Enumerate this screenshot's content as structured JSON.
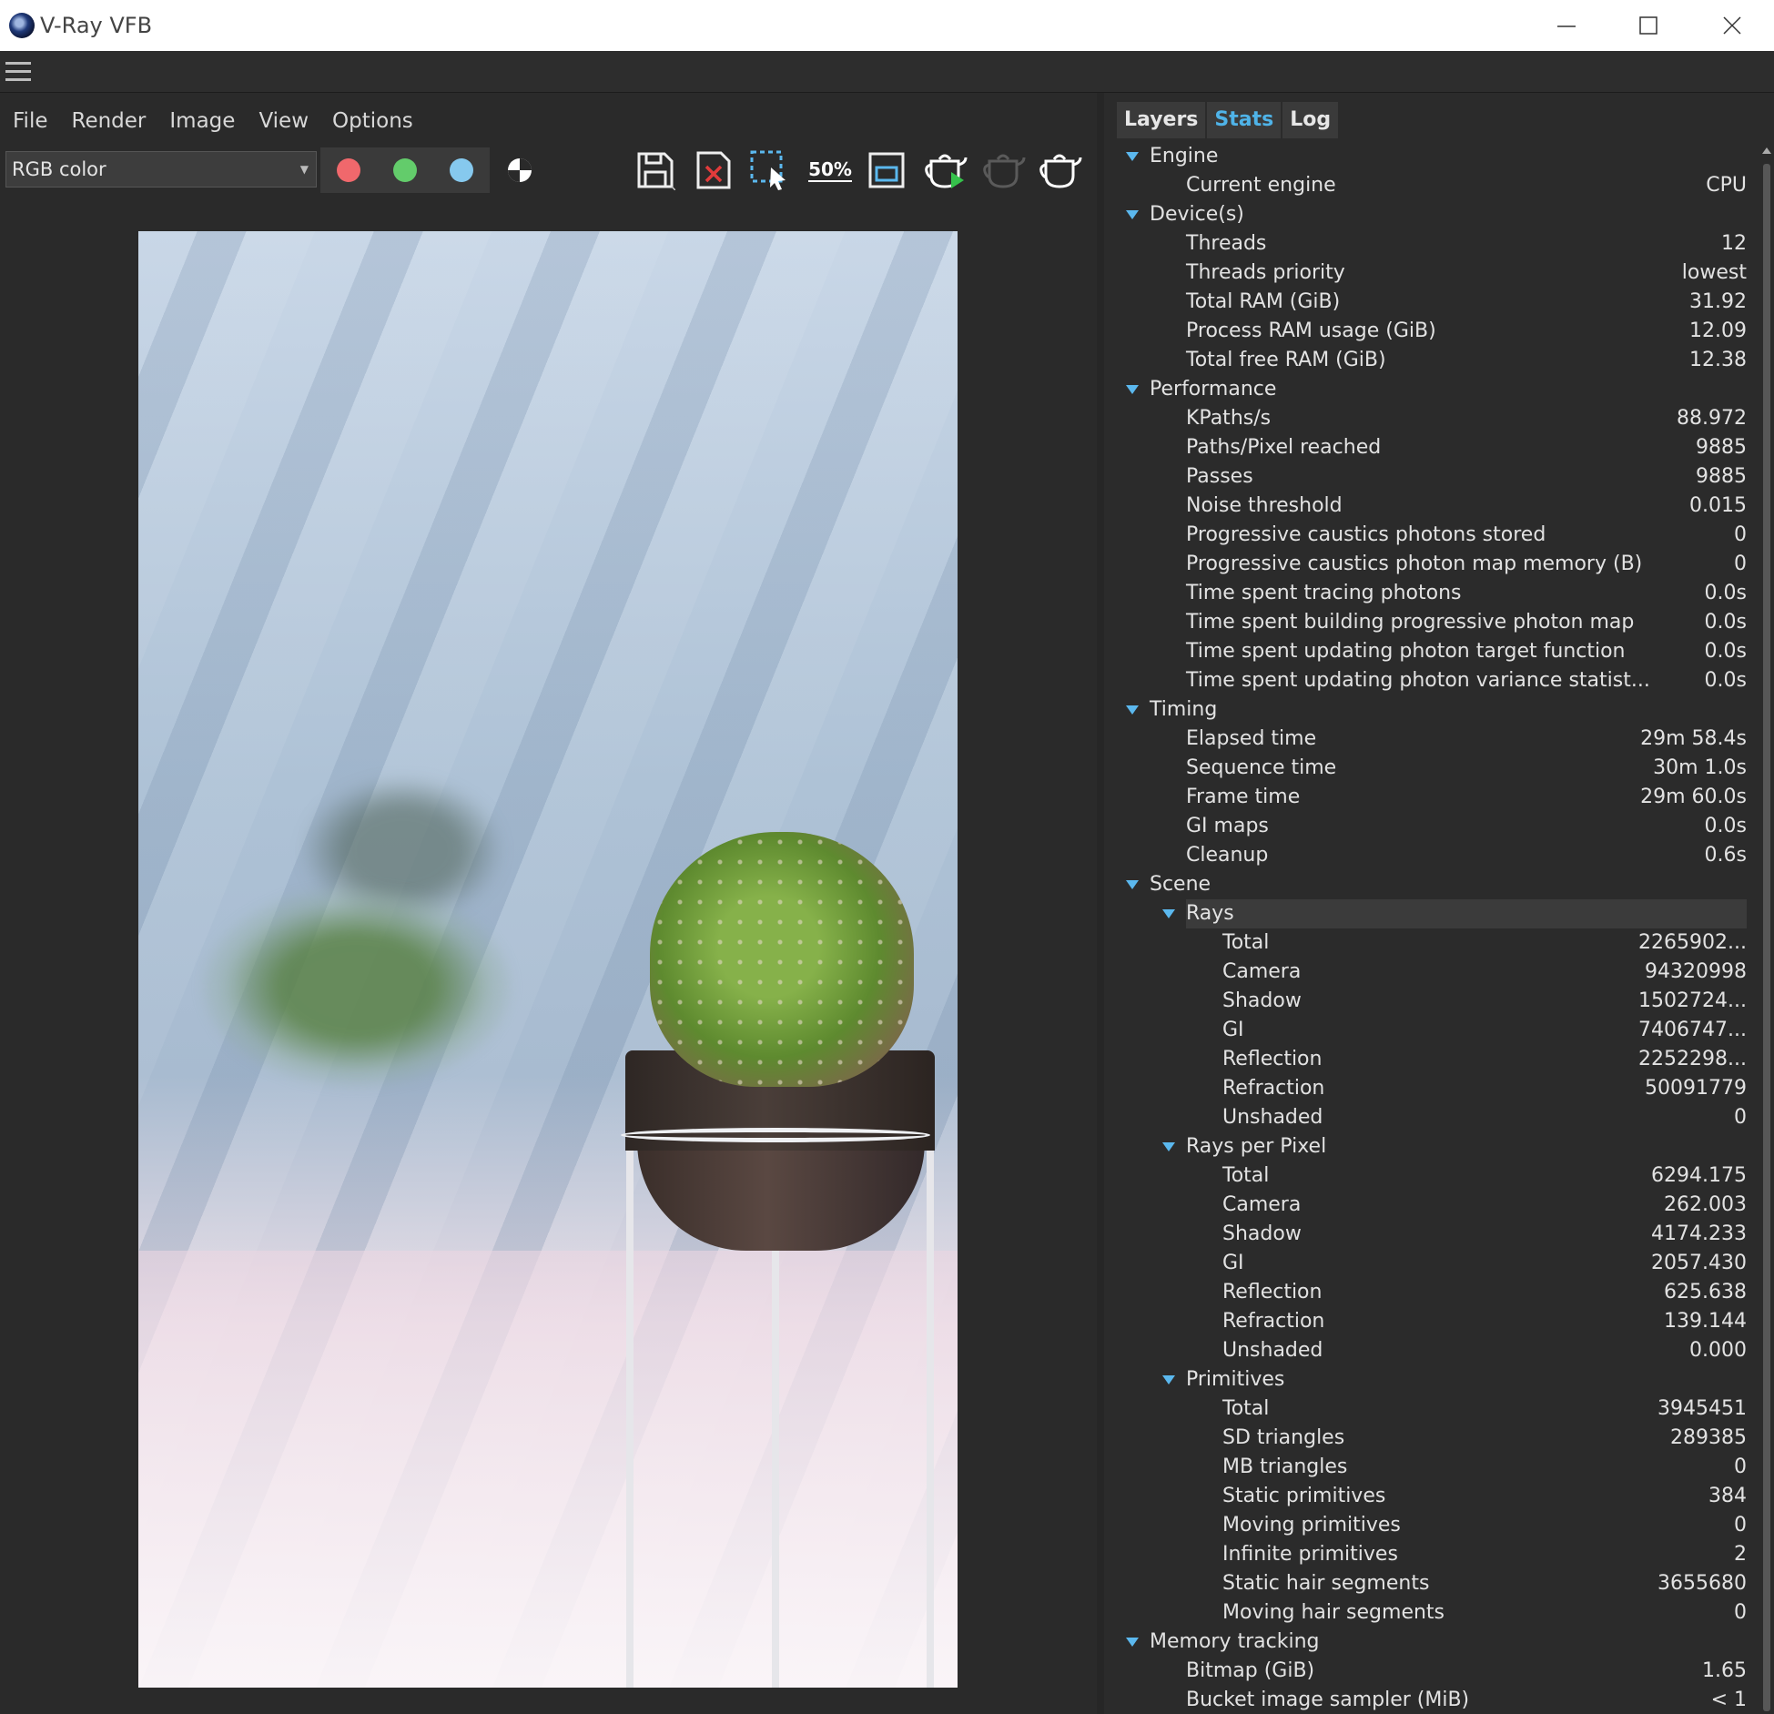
{
  "window": {
    "title": "V-Ray VFB"
  },
  "menu": [
    "File",
    "Render",
    "Image",
    "View",
    "Options"
  ],
  "toolbar": {
    "channel": "RGB color",
    "zoom_label": "50%",
    "colors": {
      "red": "#f0686c",
      "green": "#63cc6b",
      "blue": "#86c9ee"
    }
  },
  "tabs": [
    {
      "label": "Layers",
      "active": false
    },
    {
      "label": "Stats",
      "active": true
    },
    {
      "label": "Log",
      "active": false
    }
  ],
  "stats": [
    {
      "level": 0,
      "label": "Engine",
      "expanded": true
    },
    {
      "level": 1,
      "label": "Current engine",
      "value": "CPU"
    },
    {
      "level": 0,
      "label": "Device(s)",
      "expanded": true
    },
    {
      "level": 1,
      "label": "Threads",
      "value": "12"
    },
    {
      "level": 1,
      "label": "Threads priority",
      "value": "lowest"
    },
    {
      "level": 1,
      "label": "Total RAM (GiB)",
      "value": "31.92"
    },
    {
      "level": 1,
      "label": "Process RAM usage (GiB)",
      "value": "12.09"
    },
    {
      "level": 1,
      "label": "Total free RAM (GiB)",
      "value": "12.38"
    },
    {
      "level": 0,
      "label": "Performance",
      "expanded": true
    },
    {
      "level": 1,
      "label": "KPaths/s",
      "value": "88.972"
    },
    {
      "level": 1,
      "label": "Paths/Pixel reached",
      "value": "9885"
    },
    {
      "level": 1,
      "label": "Passes",
      "value": "9885"
    },
    {
      "level": 1,
      "label": "Noise threshold",
      "value": "0.015"
    },
    {
      "level": 1,
      "label": "Progressive caustics photons stored",
      "value": "0"
    },
    {
      "level": 1,
      "label": "Progressive caustics photon map memory (B)",
      "value": "0"
    },
    {
      "level": 1,
      "label": "Time spent tracing photons",
      "value": "0.0s"
    },
    {
      "level": 1,
      "label": "Time spent building progressive photon map",
      "value": "0.0s"
    },
    {
      "level": 1,
      "label": "Time spent updating photon target function",
      "value": "0.0s"
    },
    {
      "level": 1,
      "label": "Time spent updating photon variance statist...",
      "value": "0.0s"
    },
    {
      "level": 0,
      "label": "Timing",
      "expanded": true
    },
    {
      "level": 1,
      "label": "Elapsed time",
      "value": "29m 58.4s"
    },
    {
      "level": 1,
      "label": "Sequence time",
      "value": "30m 1.0s"
    },
    {
      "level": 1,
      "label": "Frame time",
      "value": "29m 60.0s"
    },
    {
      "level": 1,
      "label": "GI maps",
      "value": "0.0s"
    },
    {
      "level": 1,
      "label": "Cleanup",
      "value": "0.6s"
    },
    {
      "level": 0,
      "label": "Scene",
      "expanded": true
    },
    {
      "level": 1,
      "label": "Rays",
      "expanded": true,
      "selected": true
    },
    {
      "level": 2,
      "label": "Total",
      "value": "2265902..."
    },
    {
      "level": 2,
      "label": "Camera",
      "value": "94320998"
    },
    {
      "level": 2,
      "label": "Shadow",
      "value": "1502724..."
    },
    {
      "level": 2,
      "label": "GI",
      "value": "7406747..."
    },
    {
      "level": 2,
      "label": "Reflection",
      "value": "2252298..."
    },
    {
      "level": 2,
      "label": "Refraction",
      "value": "50091779"
    },
    {
      "level": 2,
      "label": "Unshaded",
      "value": "0"
    },
    {
      "level": 1,
      "label": "Rays per Pixel",
      "expanded": true
    },
    {
      "level": 2,
      "label": "Total",
      "value": "6294.175"
    },
    {
      "level": 2,
      "label": "Camera",
      "value": "262.003"
    },
    {
      "level": 2,
      "label": "Shadow",
      "value": "4174.233"
    },
    {
      "level": 2,
      "label": "GI",
      "value": "2057.430"
    },
    {
      "level": 2,
      "label": "Reflection",
      "value": "625.638"
    },
    {
      "level": 2,
      "label": "Refraction",
      "value": "139.144"
    },
    {
      "level": 2,
      "label": "Unshaded",
      "value": "0.000"
    },
    {
      "level": 1,
      "label": "Primitives",
      "expanded": true
    },
    {
      "level": 2,
      "label": "Total",
      "value": "3945451"
    },
    {
      "level": 2,
      "label": "SD triangles",
      "value": "289385"
    },
    {
      "level": 2,
      "label": "MB triangles",
      "value": "0"
    },
    {
      "level": 2,
      "label": "Static primitives",
      "value": "384"
    },
    {
      "level": 2,
      "label": "Moving primitives",
      "value": "0"
    },
    {
      "level": 2,
      "label": "Infinite primitives",
      "value": "2"
    },
    {
      "level": 2,
      "label": "Static hair segments",
      "value": "3655680"
    },
    {
      "level": 2,
      "label": "Moving hair segments",
      "value": "0"
    },
    {
      "level": 0,
      "label": "Memory tracking",
      "expanded": true
    },
    {
      "level": 1,
      "label": "Bitmap (GiB)",
      "value": "1.65"
    },
    {
      "level": 1,
      "label": "Bucket image sampler (MiB)",
      "value": "< 1"
    }
  ]
}
